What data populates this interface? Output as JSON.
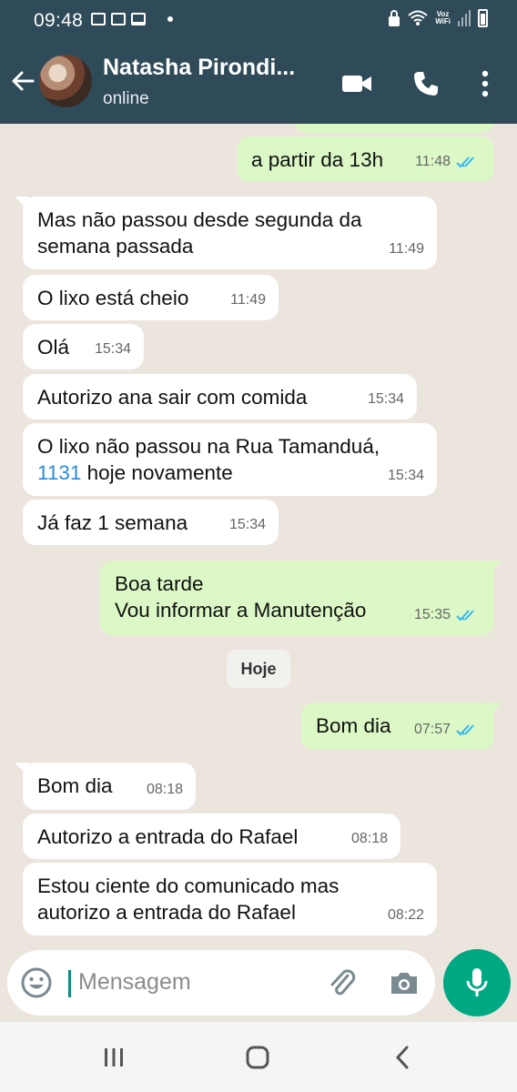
{
  "status_bar": {
    "time": "09:48",
    "voz_top": "Voz",
    "voz_bottom": "WiFi"
  },
  "header": {
    "name": "Natasha Pirondi...",
    "status": "online"
  },
  "messages": [
    {
      "text": "a partir da 13h",
      "time": "11:48"
    },
    {
      "line1": "Mas não passou desde segunda da",
      "line2": "semana passada",
      "time": "11:49"
    },
    {
      "text": "O lixo está cheio",
      "time": "11:49"
    },
    {
      "text": "Olá",
      "time": "15:34"
    },
    {
      "text": "Autorizo ana sair com comida",
      "time": "15:34"
    },
    {
      "line1": "O lixo não passou na Rua Tamanduá,",
      "number": "1131",
      "line2_rest": " hoje novamente",
      "time": "15:34"
    },
    {
      "text": "Já faz 1 semana",
      "time": "15:34"
    },
    {
      "line1": "Boa tarde",
      "line2": "Vou informar a Manutenção",
      "time": "15:35"
    },
    {
      "text": "Bom dia",
      "time": "07:57"
    },
    {
      "text": "Bom dia",
      "time": "08:18"
    },
    {
      "text": "Autorizo a entrada do Rafael",
      "time": "08:18"
    },
    {
      "line1": "Estou ciente do comunicado mas",
      "line2": "autorizo a entrada do Rafael",
      "time": "08:22"
    }
  ],
  "date_divider": "Hoje",
  "composer": {
    "placeholder": "Mensagem"
  },
  "colors": {
    "header": "#2f4a58",
    "outgoing": "#dcf8c6",
    "incoming": "#ffffff",
    "accent": "#00a884",
    "read_ticks": "#34b7f1"
  }
}
